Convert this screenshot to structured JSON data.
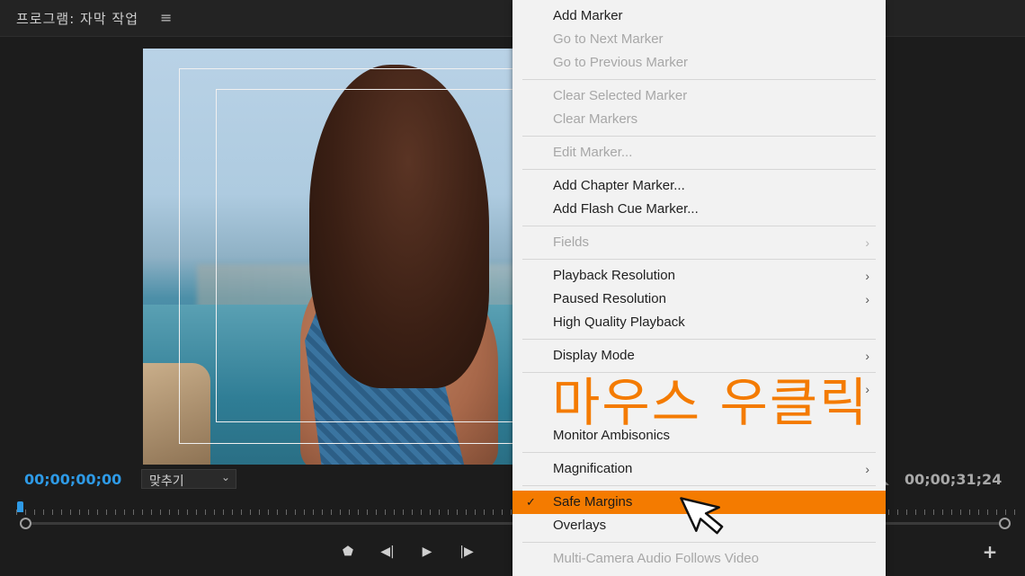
{
  "monitor": {
    "title": "프로그램: 자막 작업",
    "menu_icon": "hamburger-icon",
    "timecode_current": "00;00;00;00",
    "timecode_duration": "00;00;31;24",
    "fit": {
      "selected": "맞추기"
    }
  },
  "context_menu": {
    "items": [
      {
        "label": "Add Marker",
        "enabled": true
      },
      {
        "label": "Go to Next Marker",
        "enabled": false
      },
      {
        "label": "Go to Previous Marker",
        "enabled": false
      },
      {
        "label": "Clear Selected Marker",
        "enabled": false
      },
      {
        "label": "Clear Markers",
        "enabled": false
      },
      {
        "label": "Edit Marker...",
        "enabled": false
      },
      {
        "label": "Add Chapter Marker...",
        "enabled": true
      },
      {
        "label": "Add Flash Cue Marker...",
        "enabled": true
      },
      {
        "label": "Fields",
        "enabled": false,
        "submenu": true
      },
      {
        "label": "Playback Resolution",
        "enabled": true,
        "submenu": true
      },
      {
        "label": "Paused Resolution",
        "enabled": true,
        "submenu": true
      },
      {
        "label": "High Quality Playback",
        "enabled": true
      },
      {
        "label": "Display Mode",
        "enabled": true,
        "submenu": true
      },
      {
        "label": "Monitor Ambisonics",
        "enabled": true
      },
      {
        "label": "Magnification",
        "enabled": true,
        "submenu": true
      },
      {
        "label": "Safe Margins",
        "enabled": true,
        "checked": true,
        "highlighted": true
      },
      {
        "label": "Overlays",
        "enabled": true
      },
      {
        "label": "Multi-Camera Audio Follows Video",
        "enabled": false
      }
    ],
    "submenu_arrow": "›",
    "check_mark": "✓"
  },
  "overlay": {
    "caption": "마우스 우클릭",
    "color": "#f47b00"
  },
  "colors": {
    "accent_orange": "#f47b00",
    "timecode_blue": "#2e9ae6"
  },
  "icons": {
    "dropdown": "chevron-down-icon",
    "transport": [
      "add-marker-icon",
      "step-back-icon",
      "play-icon",
      "step-forward-icon",
      "export-frame-icon"
    ],
    "add": "plus-icon",
    "settings": "wrench-icon",
    "cursor": "mouse-pointer-icon"
  }
}
